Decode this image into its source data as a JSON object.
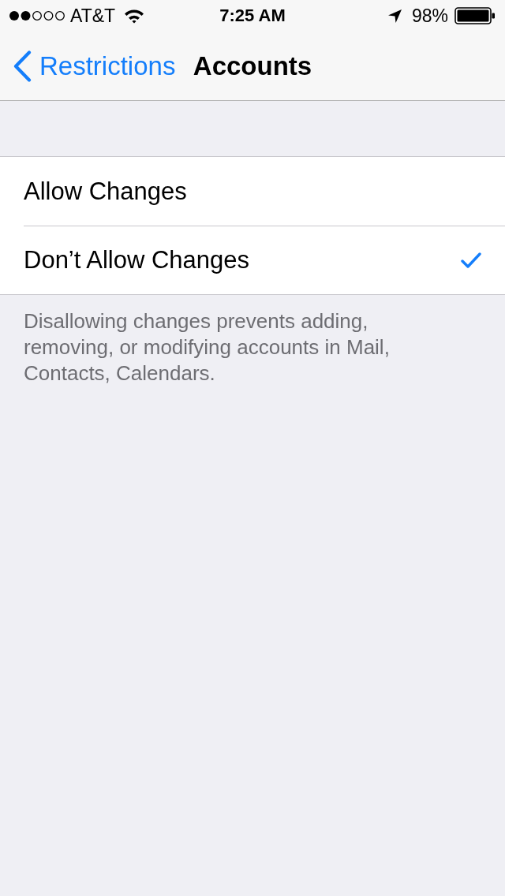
{
  "status_bar": {
    "carrier": "AT&T",
    "time": "7:25 AM",
    "battery": "98%"
  },
  "nav_bar": {
    "back": "Restrictions",
    "title": "Accounts"
  },
  "options": [
    {
      "label": "Allow Changes",
      "selected": false
    },
    {
      "label": "Don’t Allow Changes",
      "selected": true
    }
  ],
  "footer": "Disallowing changes prevents adding, removing, or modifying accounts in Mail, Contacts, Calendars."
}
